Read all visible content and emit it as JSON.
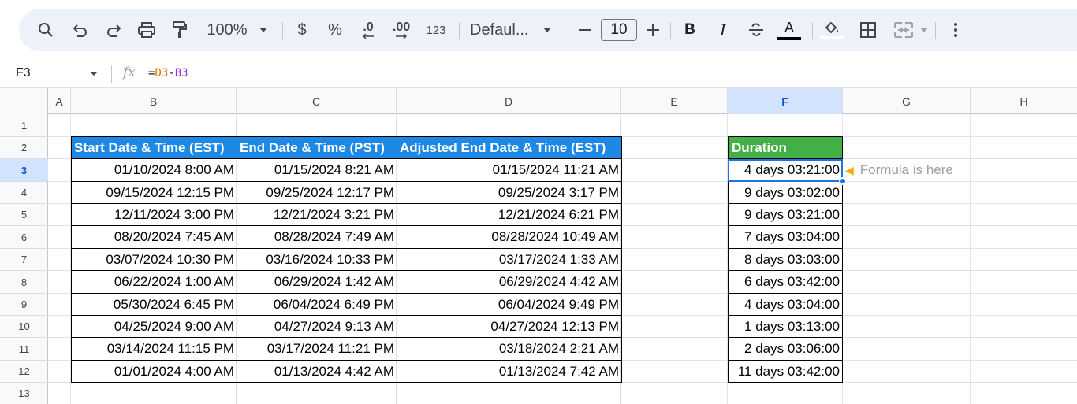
{
  "toolbar": {
    "zoom": "100%",
    "currency": "$",
    "percent": "%",
    "decrease_decimal": ".0",
    "increase_decimal": ".00",
    "number_format": "123",
    "font_family": "Defaul...",
    "font_size": "10",
    "bold": "B",
    "italic": "I",
    "text_color": "A"
  },
  "formula_bar": {
    "name_box": "F3",
    "fx": "fx",
    "formula_prefix": "=",
    "ref_1": "D3",
    "operator": "-",
    "ref_2": "B3"
  },
  "columns": [
    "A",
    "B",
    "C",
    "D",
    "E",
    "F",
    "G",
    "H"
  ],
  "rows": [
    "1",
    "2",
    "3",
    "4",
    "5",
    "6",
    "7",
    "8",
    "9",
    "10",
    "11",
    "12",
    "13"
  ],
  "table": {
    "headers": {
      "start": "Start Date & Time (EST)",
      "end": "End Date & Time (PST)",
      "adjusted": "Adjusted End Date & Time (EST)",
      "duration": "Duration"
    },
    "rows": [
      {
        "start": "01/10/2024 8:00 AM",
        "end": "01/15/2024 8:21 AM",
        "adjusted": "01/15/2024 11:21 AM",
        "duration": "4 days 03:21:00"
      },
      {
        "start": "09/15/2024 12:15 PM",
        "end": "09/25/2024 12:17 PM",
        "adjusted": "09/25/2024 3:17 PM",
        "duration": "9 days 03:02:00"
      },
      {
        "start": "12/11/2024 3:00 PM",
        "end": "12/21/2024 3:21 PM",
        "adjusted": "12/21/2024 6:21 PM",
        "duration": "9 days 03:21:00"
      },
      {
        "start": "08/20/2024 7:45 AM",
        "end": "08/28/2024 7:49 AM",
        "adjusted": "08/28/2024 10:49 AM",
        "duration": "7 days 03:04:00"
      },
      {
        "start": "03/07/2024 10:30 PM",
        "end": "03/16/2024 10:33 PM",
        "adjusted": "03/17/2024 1:33 AM",
        "duration": "8 days 03:03:00"
      },
      {
        "start": "06/22/2024 1:00 AM",
        "end": "06/29/2024 1:42 AM",
        "adjusted": "06/29/2024 4:42 AM",
        "duration": "6 days 03:42:00"
      },
      {
        "start": "05/30/2024 6:45 PM",
        "end": "06/04/2024 6:49 PM",
        "adjusted": "06/04/2024 9:49 PM",
        "duration": "4 days 03:04:00"
      },
      {
        "start": "04/25/2024 9:00 AM",
        "end": "04/27/2024 9:13 AM",
        "adjusted": "04/27/2024 12:13 PM",
        "duration": "1 days 03:13:00"
      },
      {
        "start": "03/14/2024 11:15 PM",
        "end": "03/17/2024 11:21 PM",
        "adjusted": "03/18/2024 2:21 AM",
        "duration": "2 days 03:06:00"
      },
      {
        "start": "01/01/2024 4:00 AM",
        "end": "01/13/2024 4:42 AM",
        "adjusted": "01/13/2024 7:42 AM",
        "duration": "11 days 03:42:00"
      }
    ]
  },
  "note": {
    "text": "Formula is here",
    "icon": "pointing-hand-icon"
  },
  "colors": {
    "header_blue": "#1e88e5",
    "header_green": "#43b047",
    "selection": "#1a73e8"
  }
}
